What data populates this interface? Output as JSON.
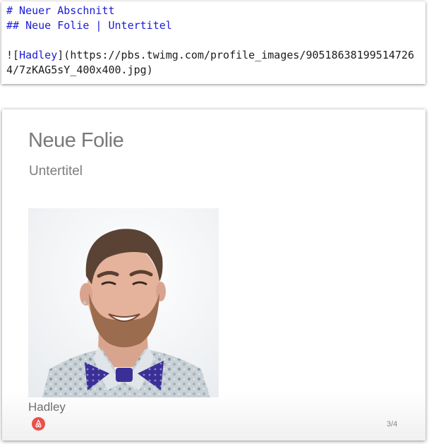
{
  "editor": {
    "lines": [
      "# Neuer Abschnitt",
      "## Neue Folie | Untertitel",
      "",
      "![Hadley](https://pbs.twimg.com/profile_images/90518638199514726",
      "4/7zKAG5sY_400x400.jpg)"
    ],
    "section_heading": "# Neuer Abschnitt",
    "slide_heading": "## Neue Folie | Untertitel",
    "image_prefix": "![",
    "image_alt": "Hadley",
    "image_mid": "](",
    "image_url_part1": "https://pbs.twimg.com/profile_images/90518638199514726",
    "image_url_part2": "4/7zKAG5sY_400x400.jpg",
    "image_suffix": ")"
  },
  "slide": {
    "title": "Neue Folie",
    "subtitle": "Untertitel",
    "image_caption": "Hadley",
    "counter": "3/4",
    "logo_icon": "airbnb-logo-icon"
  },
  "colors": {
    "markdown_keyword": "#1b1bd6",
    "slide_title": "#797979",
    "logo": "#e8514c"
  }
}
